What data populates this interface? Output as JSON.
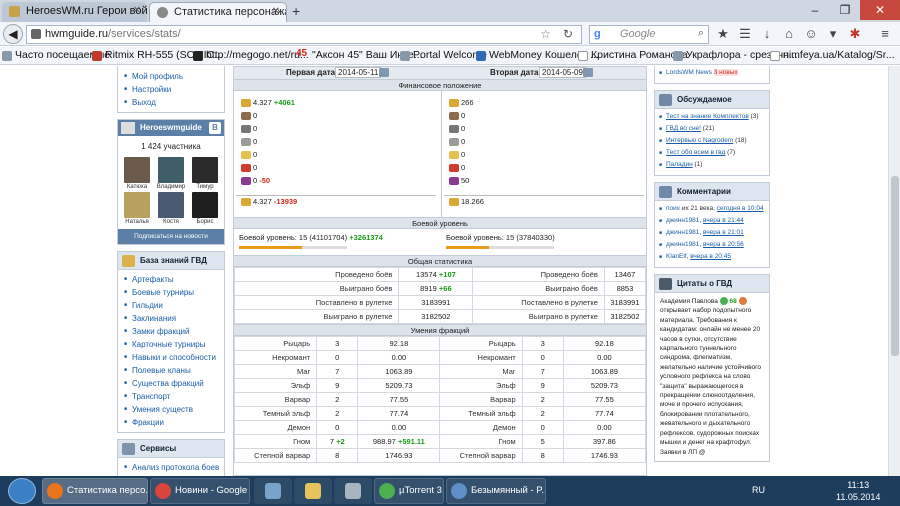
{
  "browser": {
    "tabs": [
      {
        "title": "HeroesWM.ru Герои войн..."
      },
      {
        "title": "Статистика персонажа - ..."
      }
    ],
    "url_host": "hwmguide.ru",
    "url_path": "/services/stats/",
    "search_placeholder": "Google",
    "search_engine_glyph": "g",
    "bookmarks": [
      "Часто посещаемые",
      "Ritmix RH-555 (SOMIC...",
      "http://megogo.net/ru...",
      "\"Аксон 45\" Ваш Инте...",
      "Portal Welcome",
      "WebMoney Кошелёк ...",
      "Кристина Романова",
      "Украфлора - срезанн...",
      "nimfeya.ua/Katalog/Sr..."
    ],
    "bookmark_prefix_number": "45"
  },
  "left": {
    "top_links": [
      "Мой профиль",
      "Настройки",
      "Выход"
    ],
    "vk_group": "Heroeswmguide",
    "vk_badge": "В",
    "vk_count": "1 424 участника",
    "members": [
      "Катюха",
      "Владимир",
      "Тимур",
      "Наталья",
      "Костя",
      "Борис"
    ],
    "subscribe": "Подписаться на новости",
    "kb_title": "База знаний ГВД",
    "kb_links": [
      "Артефакты",
      "Боевые турниры",
      "Гильдии",
      "Заклинания",
      "Замки фракций",
      "Карточные турниры",
      "Навыки и способности",
      "Полевые кланы",
      "Существа фракций",
      "Транспорт",
      "Умения существ",
      "Фракции"
    ],
    "services_title": "Сервисы",
    "services_links": [
      "Анализ протокола боев"
    ]
  },
  "main": {
    "first_date_label": "Первая дата:",
    "first_date": "2014-05-11",
    "second_date_label": "Вторая дата:",
    "second_date": "2014-05-09",
    "fin_title": "Финансовое положение",
    "fin_left": [
      {
        "v": "4.327",
        "d": "+4061",
        "dc": "pos"
      },
      {
        "v": "0",
        "d": "",
        "dc": ""
      },
      {
        "v": "0",
        "d": "",
        "dc": ""
      },
      {
        "v": "0",
        "d": "",
        "dc": ""
      },
      {
        "v": "0",
        "d": "",
        "dc": ""
      },
      {
        "v": "0",
        "d": "",
        "dc": ""
      },
      {
        "v": "0",
        "d": "-50",
        "dc": "neg"
      }
    ],
    "fin_right": [
      "266",
      "0",
      "0",
      "0",
      "0",
      "0",
      "50"
    ],
    "fin_total_left": "4.327",
    "fin_total_left_delta": "-13939",
    "fin_total_right": "18.266",
    "combat_title": "Боевой уровень",
    "combat_left_label": "Боевой уровень: 15 (41101704)",
    "combat_left_delta": "+3261374",
    "combat_left_progress": 0.58,
    "combat_right_label": "Боевой уровень: 15 (37840330)",
    "combat_right_progress": 0.4,
    "general_title": "Общая статистика",
    "general_rows": [
      {
        "label": "Проведено боёв",
        "l": "13574",
        "ld": "+107",
        "r": "13467"
      },
      {
        "label": "Выиграно боёв",
        "l": "8919",
        "ld": "+66",
        "r": "8853"
      },
      {
        "label": "Поставлено в рулетке",
        "l": "3183991",
        "ld": "",
        "r": "3183991"
      },
      {
        "label": "Выиграно в рулетке",
        "l": "3182502",
        "ld": "",
        "r": "3182502"
      }
    ],
    "faction_title": "Умения фракций",
    "faction_rows": [
      {
        "name": "Рыцарь",
        "l1": "3",
        "l2": "92.18",
        "l2d": "",
        "r1": "3",
        "r2": "92.18"
      },
      {
        "name": "Некромант",
        "l1": "0",
        "l2": "0.00",
        "l2d": "",
        "r1": "0",
        "r2": "0.00"
      },
      {
        "name": "Маг",
        "l1": "7",
        "l2": "1063.89",
        "l2d": "",
        "r1": "7",
        "r2": "1063.89"
      },
      {
        "name": "Эльф",
        "l1": "9",
        "l2": "5209.73",
        "l2d": "",
        "r1": "9",
        "r2": "5209.73"
      },
      {
        "name": "Варвар",
        "l1": "2",
        "l2": "77.55",
        "l2d": "",
        "r1": "2",
        "r2": "77.55"
      },
      {
        "name": "Темный эльф",
        "l1": "2",
        "l2": "77.74",
        "l2d": "",
        "r1": "2",
        "r2": "77.74"
      },
      {
        "name": "Демон",
        "l1": "0",
        "l2": "0.00",
        "l2d": "",
        "r1": "0",
        "r2": "0.00"
      },
      {
        "name": "Гном",
        "l1": "7",
        "l1d": "+2",
        "l2": "988.97",
        "l2d": "+591.11",
        "r1": "5",
        "r2": "397.86"
      },
      {
        "name": "Степной варвар",
        "l1": "8",
        "l2": "1746.93",
        "l2d": "",
        "r1": "8",
        "r2": "1746.93"
      }
    ]
  },
  "right": {
    "top_items": [
      "LordsWM News"
    ],
    "top_new": "3 новых",
    "discuss_title": "Обсуждаемое",
    "discuss": [
      {
        "t": "Тест на знание Комплектов",
        "c": "(3)"
      },
      {
        "t": "ГВД во сне!",
        "c": "(21)"
      },
      {
        "t": "Интервью с Nagrodem",
        "c": "(18)"
      },
      {
        "t": "Тест обо всем в гвд",
        "c": "(7)"
      },
      {
        "t": "Паладин",
        "c": "(1)"
      }
    ],
    "comments_title": "Комментарии",
    "comments": [
      {
        "a": "поих",
        "m": " их 21 века, ",
        "w": "сегодня в 10:04"
      },
      {
        "a": "джинн1981",
        "m": ", ",
        "w": "вчера в 21:44"
      },
      {
        "a": "джинн1981",
        "m": ", ",
        "w": "вчера в 21:01"
      },
      {
        "a": "джинн1981",
        "m": ", ",
        "w": "вчера в 20:56"
      },
      {
        "a": "KlanElf",
        "m": ", ",
        "w": "вчера в 20:45"
      }
    ],
    "quotes_title": "Цитаты о ГВД",
    "quote_author": "Академия Павлова",
    "quote_score": "68",
    "quote_text": "открывает набор подопытного материала. Требования к кандидатам: онлайн не менее 20 часов в сутки, отсутствие карпального туннельного синдрома, флегматизм, желательно наличие устойчивого условного рефлекса на слово \"защита\" выражающегося в прекращении слюноотделения, моче и прочего испускания, блокировании плотательного, жевательного и дыхательного рефлексов, судорожных поисках мышки и денег на крафтофул. Заявки в ЛП @"
  },
  "taskbar": {
    "items": [
      "Статистика персо...",
      "Новини - Google ...",
      "µTorrent 3.4.1 (b...",
      "Безымянный - P..."
    ],
    "lang": "RU",
    "time": "11:13",
    "date": "11.05.2014"
  }
}
